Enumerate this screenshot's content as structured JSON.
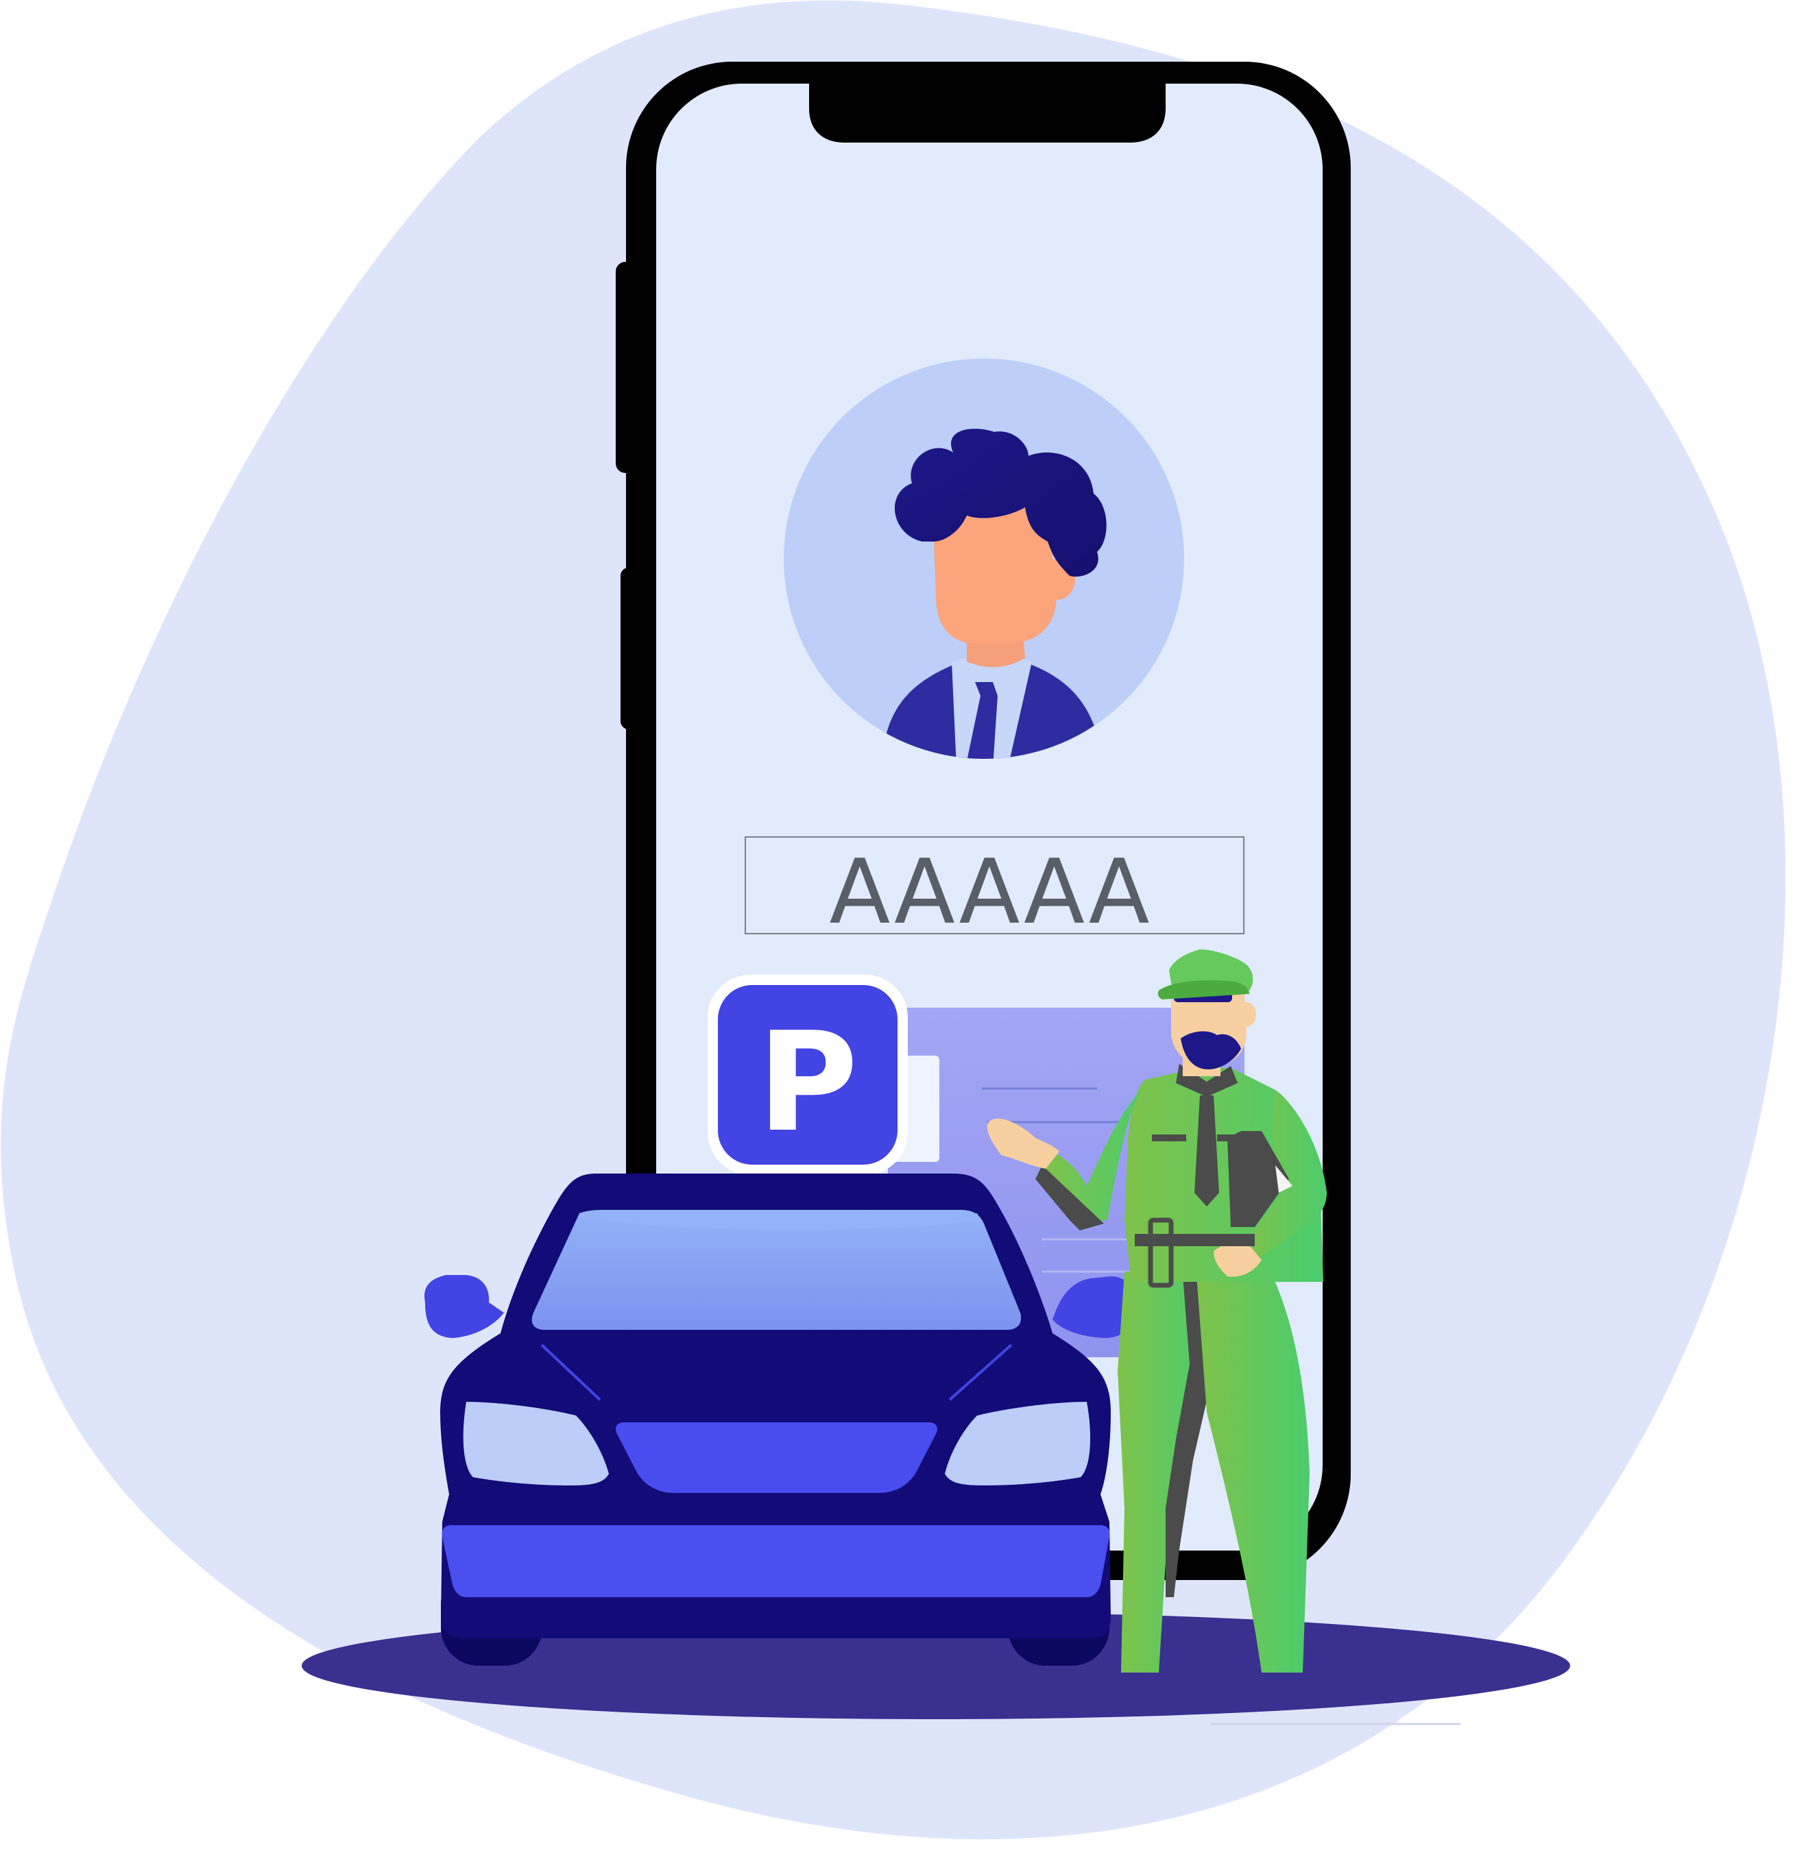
{
  "profile": {
    "name_field_value": "AAAAA"
  },
  "parking_sign": {
    "letter": "P"
  },
  "icons": {
    "avatar": "user-avatar-icon",
    "parking": "parking-sign-icon",
    "car": "car-icon",
    "attendant": "parking-attendant-icon"
  },
  "colors": {
    "blob": "#dee5fb",
    "phone_frame": "#000000",
    "screen": "#e1ebfc",
    "avatar_bg": "#bdcff8",
    "parking_blue": "#4244e3",
    "car_body": "#130b78",
    "shadow": "#3a3090",
    "uniform_green": "#66c95c",
    "name_text": "#5a5e66"
  }
}
